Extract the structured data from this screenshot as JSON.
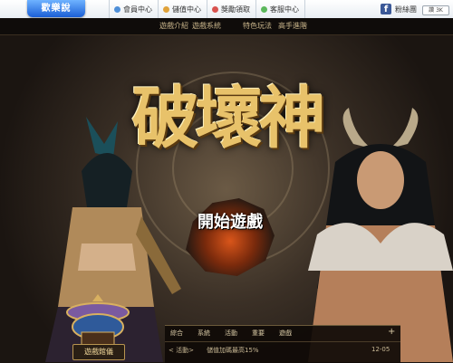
{
  "portal": {
    "logo_text": "歡樂說",
    "links": [
      {
        "label": "會員中心",
        "icon": "member-icon"
      },
      {
        "label": "儲值中心",
        "icon": "store-value-icon"
      },
      {
        "label": "獎勵領取",
        "icon": "reward-icon"
      },
      {
        "label": "客服中心",
        "icon": "support-icon"
      }
    ],
    "facebook": {
      "icon_text": "f",
      "label": "粉絲團",
      "button": "讚 3K"
    }
  },
  "game_nav": {
    "items": [
      "遊戲介紹",
      "遊戲系統",
      "特色玩法",
      "高手進階"
    ]
  },
  "hero": {
    "title": "破壞神",
    "start_label": "開始遊戲"
  },
  "news": {
    "tabs": [
      "綜合",
      "系統",
      "活動",
      "重要",
      "遊戲"
    ],
    "plus": "+",
    "items": [
      {
        "tag": "< 活動>",
        "text": "儲值加碼最高15%",
        "date": "12-05"
      }
    ]
  },
  "side_portal": {
    "label": "遊戲館儀"
  }
}
